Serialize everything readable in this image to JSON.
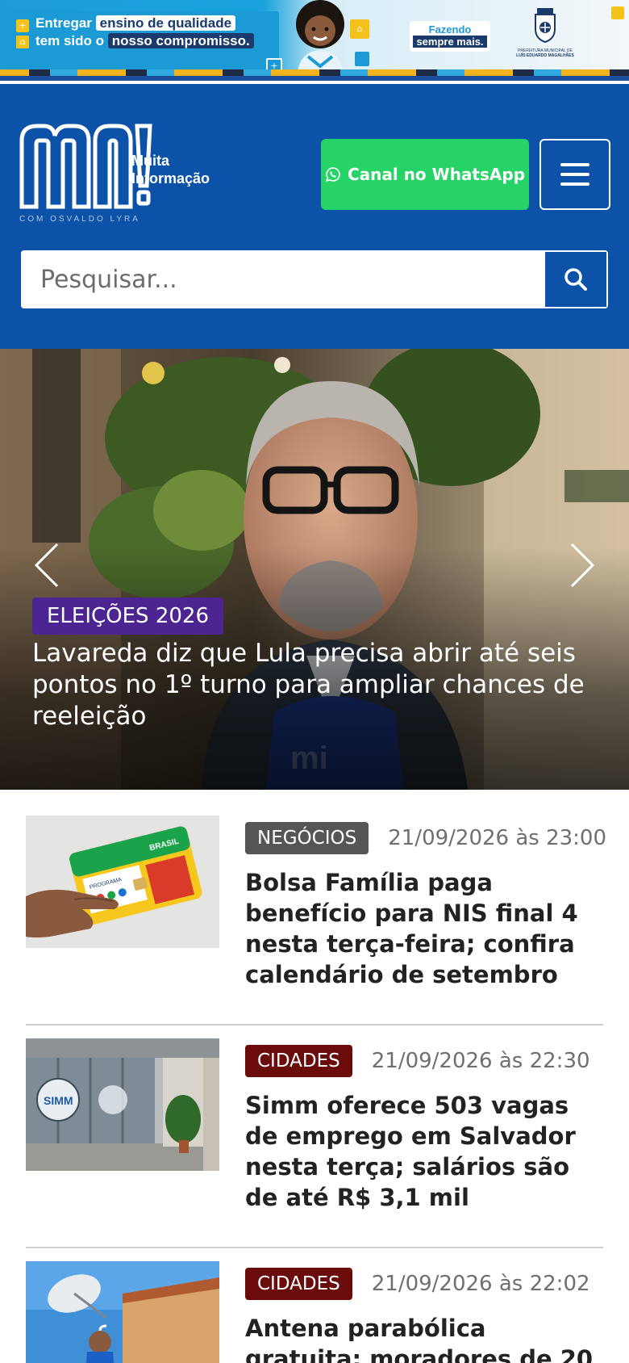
{
  "ad_banner": {
    "line1_plain": "Entregar",
    "line1_highlight": "ensino de qualidade",
    "line2_plain": "tem sido o",
    "line2_highlight": "nosso compromisso.",
    "badge_line1": "Fazendo",
    "badge_line2": "sempre mais.",
    "sponsor_line1": "PREFEITURA MUNICIPAL DE",
    "sponsor_line2": "LUÍS EDUARDO MAGALHÃES",
    "colors": {
      "blue": "#1b9ad6",
      "navy": "#1a3a6b",
      "yellow": "#f5c21b"
    }
  },
  "header": {
    "logo_line1": "Muita",
    "logo_line2": "Informação",
    "logo_tagline": "COM OSVALDO LYRA",
    "whatsapp_label": "Canal no WhatsApp",
    "whatsapp_icon": "whatsapp-icon",
    "menu_icon": "hamburger-menu-icon",
    "search_placeholder": "Pesquisar...",
    "search_icon": "search-icon",
    "colors": {
      "background": "#0b52a8",
      "whatsapp": "#25d366"
    }
  },
  "hero": {
    "category": "ELEIÇÕES 2026",
    "title": "Lavareda diz que Lula precisa abrir até seis pontos no 1º turno para ampliar chances de reeleição",
    "prev_icon": "chevron-left-icon",
    "next_icon": "chevron-right-icon",
    "category_color": "#4d2593"
  },
  "news": [
    {
      "category": "NEGÓCIOS",
      "date": "21/09/2026 às 23:00",
      "title": "Bolsa Família paga benefício para NIS final 4 nesta terça-feira; confira calendário de setembro",
      "card_program": "PROGRAMA",
      "card_brand": "BRASIL",
      "tag_color": "#555555"
    },
    {
      "category": "CIDADES",
      "date": "21/09/2026 às 22:30",
      "title": "Simm oferece 503 vagas de emprego em Salvador nesta terça; salários são de até R$ 3,1 mil",
      "sign_text": "SIMM",
      "tag_color": "#6b0c0c"
    },
    {
      "category": "CIDADES",
      "date": "21/09/2026 às 22:02",
      "title": "Antena parabólica gratuita: moradores de 20",
      "tag_color": "#6b0c0c"
    }
  ]
}
